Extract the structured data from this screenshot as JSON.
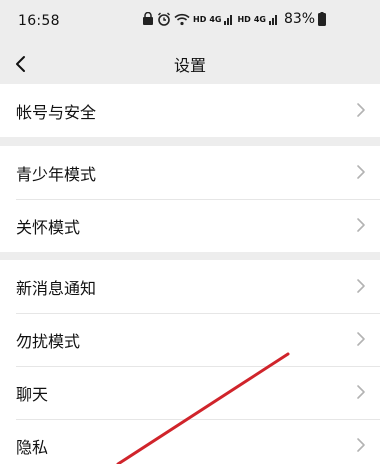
{
  "status_bar": {
    "time": "16:58",
    "network_1": "HD",
    "network_2": "HD",
    "signal_1": "4G",
    "signal_2": "4G",
    "battery": "83%"
  },
  "header": {
    "title": "设置"
  },
  "groups": [
    {
      "items": [
        {
          "label": "帐号与安全"
        }
      ]
    },
    {
      "items": [
        {
          "label": "青少年模式"
        },
        {
          "label": "关怀模式"
        }
      ]
    },
    {
      "items": [
        {
          "label": "新消息通知"
        },
        {
          "label": "勿扰模式"
        },
        {
          "label": "聊天"
        },
        {
          "label": "隐私"
        }
      ]
    }
  ],
  "colors": {
    "background": "#ededed",
    "row": "#ffffff",
    "annotation": "#d0242b"
  }
}
